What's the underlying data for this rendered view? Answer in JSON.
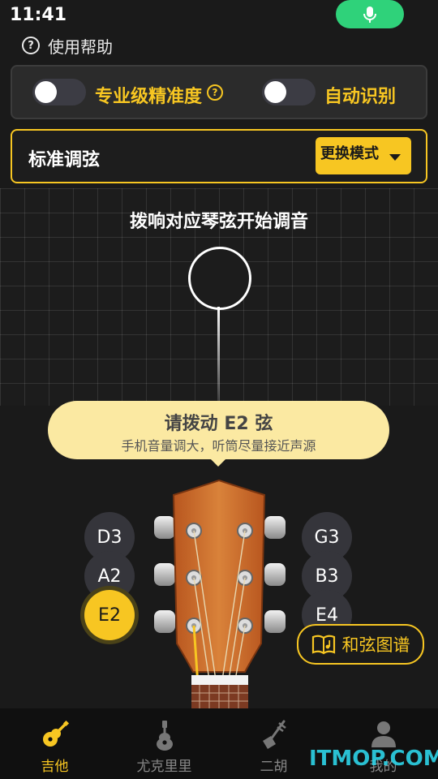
{
  "status": {
    "time": "11:41"
  },
  "colors": {
    "accent": "#f7c622",
    "mic": "#2fd27a",
    "background": "#1a1a1a"
  },
  "help": {
    "label": "使用帮助"
  },
  "settings": {
    "precision_label": "专业级精准度",
    "precision_on": false,
    "auto_detect_label": "自动识别",
    "auto_detect_on": false
  },
  "mode": {
    "title": "标准调弦",
    "change_button": "更换模式"
  },
  "tuner": {
    "prompt": "拨响对应琴弦开始调音"
  },
  "hint": {
    "title": "请拨动 E2 弦",
    "subtitle": "手机音量调大，听筒尽量接近声源"
  },
  "strings": {
    "left": [
      "D3",
      "A2",
      "E2"
    ],
    "right": [
      "G3",
      "B3",
      "E4"
    ],
    "selected": "E2"
  },
  "chord_chart": {
    "label": "和弦图谱"
  },
  "tabs": [
    {
      "label": "吉他",
      "icon": "guitar-icon",
      "active": true
    },
    {
      "label": "尤克里里",
      "icon": "ukulele-icon",
      "active": false
    },
    {
      "label": "二胡",
      "icon": "erhu-icon",
      "active": false
    },
    {
      "label": "我的",
      "icon": "user-icon",
      "active": false
    }
  ],
  "watermark": "ITMOP.COM"
}
